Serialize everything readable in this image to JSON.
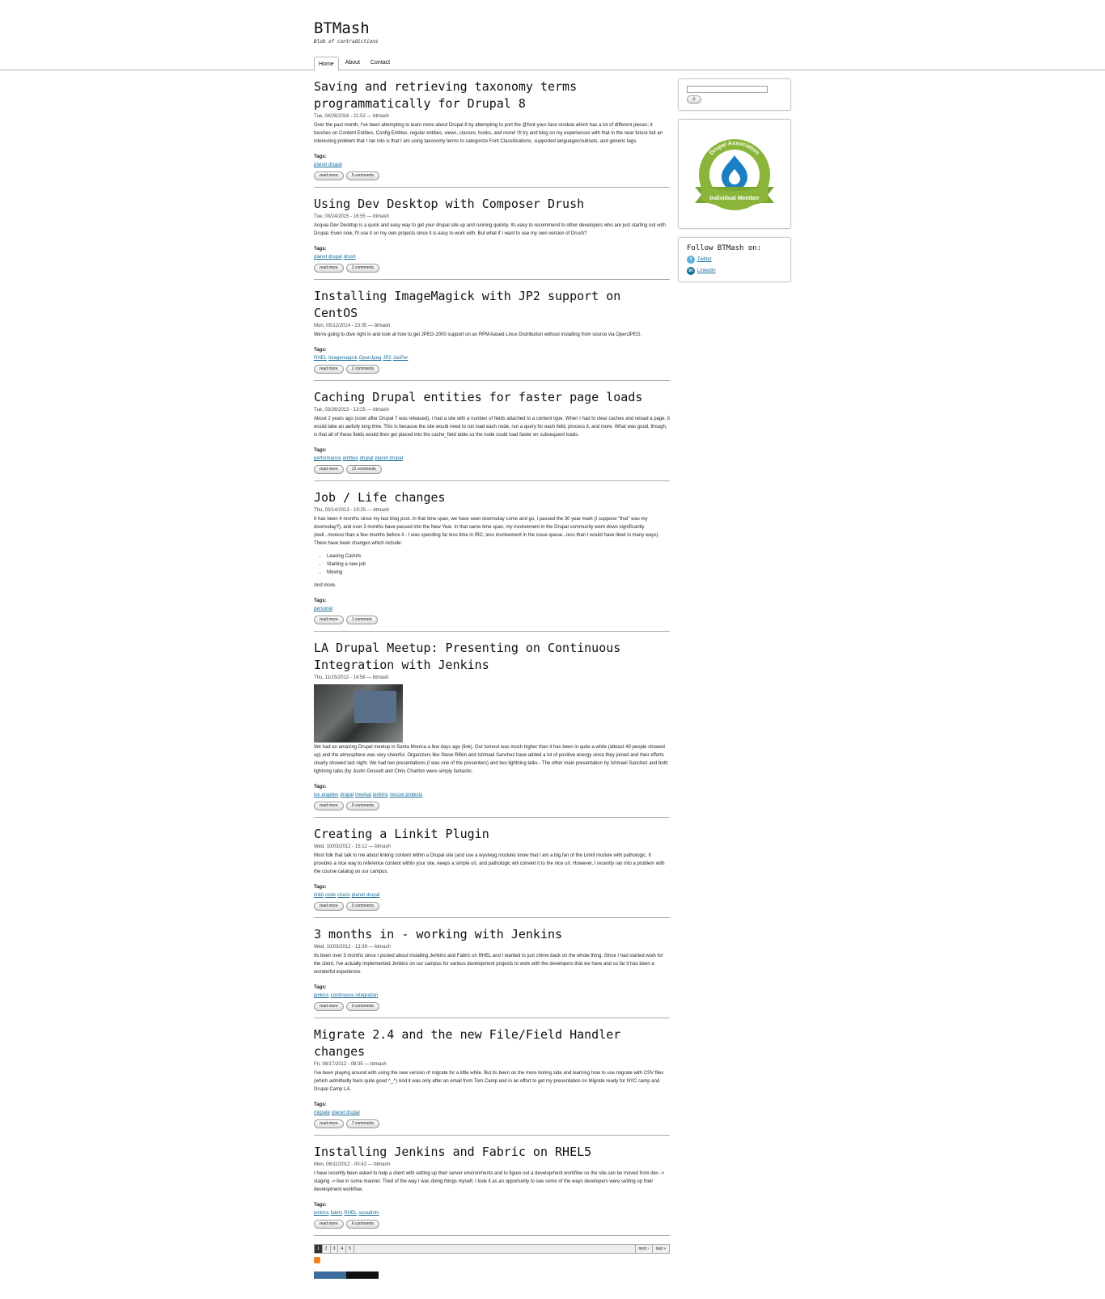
{
  "site": {
    "name": "BTMash",
    "slogan": "Blob of contradictions"
  },
  "nav": [
    {
      "label": "Home",
      "active": true
    },
    {
      "label": "About",
      "active": false
    },
    {
      "label": "Contact",
      "active": false
    }
  ],
  "posts": [
    {
      "title": "Saving and retrieving taxonomy terms programmatically for Drupal 8",
      "meta": "Tue, 04/26/2016 - 21:52 — btmash",
      "body": "Over the past month, I've been attempting to learn more about Drupal 8 by attempting to port the @font-your-face module which has a lot of different pieces; it touches on Content Entities, Config Entities, regular entities, views, classes, hooks, and more! I'll try and blog on my experiences with that in the near future but an interesting problem that I ran into is that I am using taxonomy terms to categorize Font Classifications, supported languages/subsets, and generic tags.",
      "tags": [
        "planet drupal"
      ],
      "read_more": "read more",
      "comments": "5 comments"
    },
    {
      "title": "Using Dev Desktop with Composer Drush",
      "meta": "Tue, 03/24/2015 - 16:55 — btmash",
      "body": "Acquia Dev Desktop is a quick and easy way to get your drupal site up and running quickly. Its easy to recommend to other developers who are just starting out with Drupal. Even now, I'll use it on my own projects since it is easy to work with. But what if I want to use my own version of Drush?",
      "tags": [
        "planet drupal",
        "drush"
      ],
      "read_more": "read more",
      "comments": "2 comments"
    },
    {
      "title": "Installing ImageMagick with JP2 support on CentOS",
      "meta": "Mon, 05/12/2014 - 23:35 — btmash",
      "body": "We're going to dive right in and look at how to get JPEG-2000 support on an RPM-based Linux Distribution without installing from source via OpenJPEG.",
      "tags": [
        "RHEL",
        "Imagemagick",
        "OpenJpeg",
        "JP2",
        "JasPer"
      ],
      "read_more": "read more",
      "comments": "2 comments"
    },
    {
      "title": "Caching Drupal entities for faster page loads",
      "meta": "Tue, 03/26/2013 - 13:25 — btmash",
      "body": "About 2 years ago (soon after Drupal 7 was released), I had a site with a number of fields attached to a content type. When I had to clear caches and reload a page, it would take an awfully long time. This is because the site would need to run load each node, run a query for each field, process it, and more. What was good, though, is that all of these fields would then get placed into the cache_field table so the node could load faster on subsequent loads.",
      "tags": [
        "performance",
        "entities",
        "drupal",
        "planet drupal"
      ],
      "read_more": "read more",
      "comments": "12 comments"
    },
    {
      "title": "Job / Life changes",
      "meta": "Thu, 03/14/2013 - 19:25 — btmash",
      "body": "It has been 4 months since my last blog post. In that time span, we have seen doomsday come and go, I passed the 30 year mark (I suppose \"that\" was my doomsday?), and over 3 months have passed into the New Year. In that same time span, my involvement in the Drupal community went down significantly (well...moreso than a few months before it - I was spending far less time in IRC, less involvement in the issue queue...less than I would have liked in many ways). There have been changes which include:",
      "list": [
        "Leaving CalArts",
        "Starting a new job",
        "Moving"
      ],
      "after": "And more.",
      "tags": [
        "personal"
      ],
      "read_more": "read more",
      "comments": "1 comment"
    },
    {
      "title": "LA Drupal Meetup: Presenting on Continuous Integration with Jenkins",
      "meta": "Thu, 11/15/2012 - 14:58 — btmash",
      "body": "We had an amazing Drupal meetup in Santa Monica a few days ago (link). Our turnout was much higher than it has been in quite a while (atleast 40 people showed up) and the atmosphere was very cheerful. Organizers like Steve Rifkin and Ishmael Sanchez have added a lot of positive energy since they joined and their efforts clearly showed last night. We had two presentations (I was one of the presenters) and two lightning talks - The other main presentation by Ishmael Sanchez and both lightning talks (by Justin Gossett and Chris Charlton were simply fantastic.",
      "tags": [
        "los angeles",
        "drupal",
        "meetup",
        "jenkins",
        "rescue projects"
      ],
      "read_more": "read more",
      "comments": "0 comments"
    },
    {
      "title": "Creating a Linkit Plugin",
      "meta": "Wed, 10/03/2012 - 15:12 — btmash",
      "body": "Most folk that talk to me about linking content within a Drupal site (and use a wysiwyg module) know that I am a big fan of the Linkit module with pathologic. It provides a nice way to reference content within your site, keeps a simple url, and pathologic will convert it to the nice url. However, I recently ran into a problem with the course catalog on our campus.",
      "tags": [
        "linkit",
        "code",
        "ctools",
        "planet drupal"
      ],
      "read_more": "read more",
      "comments": "5 comments"
    },
    {
      "title": "3 months in - working with Jenkins",
      "meta": "Wed, 10/03/2012 - 13:39 — btmash",
      "body": "Its been over 3 months since I posted about installing Jenkins and Fabric on RHEL and I wanted to just chime back on the whole thing. Since I had started work for the client, I've actually implemented Jenkins on our campus for various development projects to work with the developers that we have and so far it has been a wonderful experience.",
      "tags": [
        "jenkins",
        "continuous integration"
      ],
      "read_more": "read more",
      "comments": "0 comments"
    },
    {
      "title": "Migrate 2.4 and the new File/Field Handler changes",
      "meta": "Fri, 08/17/2012 - 08:35 — btmash",
      "body": "I've been playing around with using the new version of migrate for a little while. But its been on the more boring side and learning how to use migrate with CSV files (which admittedly feels quite good ^_^) And it was only after an email from Tom Camp and in an effort to get my presentation on Migrate ready for NYC camp and Drupal Camp LA.",
      "tags": [
        "migrate",
        "planet drupal"
      ],
      "read_more": "read more",
      "comments": "7 comments"
    },
    {
      "title": "Installing Jenkins and Fabric on RHEL5",
      "meta": "Mon, 06/11/2012 - 00:42 — btmash",
      "body": "I have recently been asked to help a client with setting up their server environments and to figure out a development workflow so the site can be moved from dev -> staging -> live in some manner. Tired of the way I was doing things myself, I took it as an opportunity to see some of the ways developers were setting up their development workflow.",
      "tags": [
        "jenkins",
        "fabric",
        "RHEL",
        "sysadmin"
      ],
      "read_more": "read more",
      "comments": "6 comments"
    }
  ],
  "tags_label": "Tags:",
  "pager": {
    "pages": [
      "1",
      "2",
      "3",
      "4",
      "5"
    ],
    "next": "next ›",
    "last": "last »"
  },
  "sidebar": {
    "badge_top": "Drupal Association",
    "badge_bottom": "Individual Member",
    "follow_title": "Follow BTMash on:",
    "twitter": "Twitter",
    "linkedin": "LinkedIn"
  },
  "colors": {
    "link": "#1a6e9a",
    "badge_green": "#8ab53a",
    "badge_blue": "#1d7fc3",
    "feed": "#f58220"
  }
}
